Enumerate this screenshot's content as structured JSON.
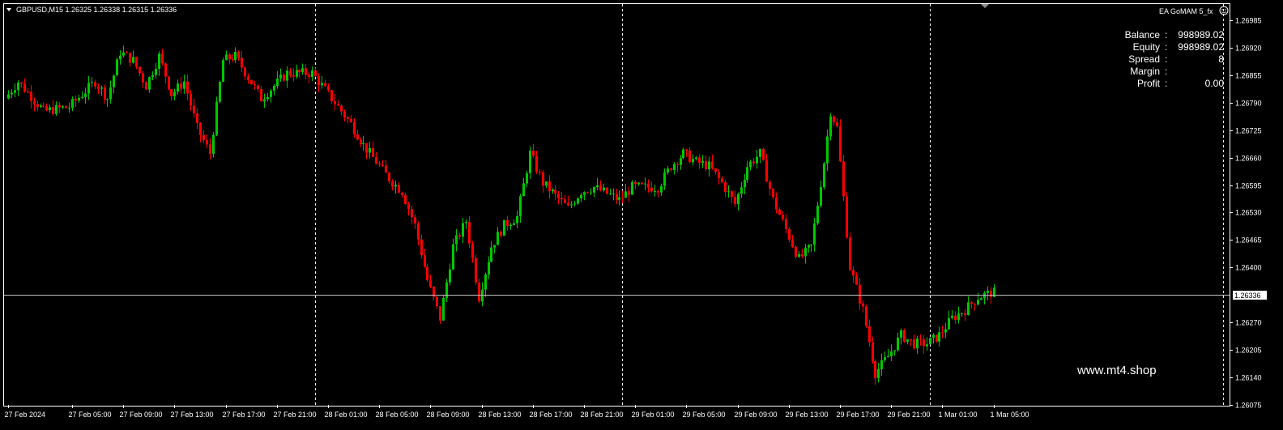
{
  "header": {
    "symbol_line": "GBPUSD,M15  1.26325 1.26338 1.26315 1.26336",
    "ea_label": "EA GoMAM 5_fx"
  },
  "account": {
    "rows": [
      {
        "label": "Balance",
        "sep": ":",
        "value": "998989.02"
      },
      {
        "label": "Equity",
        "sep": ":",
        "value": "998989.02"
      },
      {
        "label": "Spread",
        "sep": ":",
        "value": "8"
      },
      {
        "label": "Margin",
        "sep": ":",
        "value": ""
      },
      {
        "label": "Profit",
        "sep": ":",
        "value": "0.00"
      }
    ]
  },
  "watermark": "www.mt4.shop",
  "colors": {
    "background": "#000000",
    "up_candle": "#00c800",
    "down_candle": "#ff0000",
    "grid": "#ffffff",
    "price_line": "#c0c0c0"
  },
  "chart_data": {
    "type": "candlestick",
    "symbol": "GBPUSD",
    "timeframe": "M15",
    "current_price": 1.26336,
    "ylim": [
      1.26075,
      1.26985
    ],
    "y_ticks": [
      "1.26985",
      "1.26920",
      "1.26855",
      "1.26790",
      "1.26725",
      "1.26660",
      "1.26595",
      "1.26530",
      "1.26465",
      "1.26400",
      "1.26270",
      "1.26205",
      "1.26140",
      "1.26075"
    ],
    "current_price_label": "1.26336",
    "x_ticks": [
      "27 Feb 2024",
      "27 Feb 05:00",
      "27 Feb 09:00",
      "27 Feb 13:00",
      "27 Feb 17:00",
      "27 Feb 21:00",
      "28 Feb 01:00",
      "28 Feb 05:00",
      "28 Feb 09:00",
      "28 Feb 13:00",
      "28 Feb 17:00",
      "28 Feb 21:00",
      "29 Feb 01:00",
      "29 Feb 05:00",
      "29 Feb 09:00",
      "29 Feb 13:00",
      "29 Feb 17:00",
      "29 Feb 21:00",
      "1 Mar 01:00",
      "1 Mar 05:00"
    ],
    "day_separators": [
      "28 Feb 00:00",
      "29 Feb 00:00",
      "1 Mar 00:00"
    ],
    "path": [
      [
        "27 Feb 2024",
        1.268
      ],
      [
        "27 Feb 01:00",
        1.2684
      ],
      [
        "27 Feb 03:00",
        1.2677
      ],
      [
        "27 Feb 05:00",
        1.2678
      ],
      [
        "27 Feb 07:00",
        1.2684
      ],
      [
        "27 Feb 08:00",
        1.268
      ],
      [
        "27 Feb 09:00",
        1.2691
      ],
      [
        "27 Feb 10:00",
        1.2689
      ],
      [
        "27 Feb 11:00",
        1.2683
      ],
      [
        "27 Feb 12:00",
        1.269
      ],
      [
        "27 Feb 13:00",
        1.2681
      ],
      [
        "27 Feb 14:00",
        1.2684
      ],
      [
        "27 Feb 15:00",
        1.2673
      ],
      [
        "27 Feb 16:00",
        1.2667
      ],
      [
        "27 Feb 17:00",
        1.2689
      ],
      [
        "27 Feb 18:00",
        1.269
      ],
      [
        "27 Feb 19:00",
        1.2685
      ],
      [
        "27 Feb 20:00",
        1.268
      ],
      [
        "27 Feb 21:00",
        1.2683
      ],
      [
        "27 Feb 22:00",
        1.2686
      ],
      [
        "28 Feb 00:00",
        1.2686
      ],
      [
        "28 Feb 01:00",
        1.2682
      ],
      [
        "28 Feb 02:00",
        1.2678
      ],
      [
        "28 Feb 03:00",
        1.2674
      ],
      [
        "28 Feb 04:00",
        1.2669
      ],
      [
        "28 Feb 05:00",
        1.2665
      ],
      [
        "28 Feb 06:00",
        1.2661
      ],
      [
        "28 Feb 07:00",
        1.2658
      ],
      [
        "28 Feb 08:00",
        1.265
      ],
      [
        "28 Feb 09:00",
        1.2637
      ],
      [
        "28 Feb 10:00",
        1.2628
      ],
      [
        "28 Feb 11:00",
        1.2645
      ],
      [
        "28 Feb 12:00",
        1.2651
      ],
      [
        "28 Feb 13:00",
        1.2633
      ],
      [
        "28 Feb 14:00",
        1.2645
      ],
      [
        "28 Feb 15:00",
        1.265
      ],
      [
        "28 Feb 16:00",
        1.2652
      ],
      [
        "28 Feb 17:00",
        1.2667
      ],
      [
        "28 Feb 18:00",
        1.266
      ],
      [
        "28 Feb 19:00",
        1.2657
      ],
      [
        "28 Feb 20:00",
        1.2654
      ],
      [
        "28 Feb 21:00",
        1.2658
      ],
      [
        "28 Feb 22:00",
        1.2659
      ],
      [
        "29 Feb 00:00",
        1.2656
      ],
      [
        "29 Feb 01:00",
        1.2659
      ],
      [
        "29 Feb 02:00",
        1.2659
      ],
      [
        "29 Feb 03:00",
        1.2659
      ],
      [
        "29 Feb 04:00",
        1.2664
      ],
      [
        "29 Feb 05:00",
        1.2667
      ],
      [
        "29 Feb 06:00",
        1.2665
      ],
      [
        "29 Feb 07:00",
        1.2664
      ],
      [
        "29 Feb 08:00",
        1.266
      ],
      [
        "29 Feb 09:00",
        1.2655
      ],
      [
        "29 Feb 10:00",
        1.2664
      ],
      [
        "29 Feb 11:00",
        1.2667
      ],
      [
        "29 Feb 12:00",
        1.2656
      ],
      [
        "29 Feb 13:00",
        1.2649
      ],
      [
        "29 Feb 14:00",
        1.2642
      ],
      [
        "29 Feb 15:00",
        1.2645
      ],
      [
        "29 Feb 16:00",
        1.2665
      ],
      [
        "29 Feb 16:30",
        1.2677
      ],
      [
        "29 Feb 17:00",
        1.2673
      ],
      [
        "29 Feb 18:00",
        1.264
      ],
      [
        "29 Feb 19:00",
        1.263
      ],
      [
        "29 Feb 20:00",
        1.2615
      ],
      [
        "29 Feb 21:00",
        1.2619
      ],
      [
        "29 Feb 22:00",
        1.2624
      ],
      [
        "29 Feb 23:00",
        1.2622
      ],
      [
        "1 Mar 00:00",
        1.2622
      ],
      [
        "1 Mar 01:00",
        1.2624
      ],
      [
        "1 Mar 02:00",
        1.2628
      ],
      [
        "1 Mar 03:00",
        1.263
      ],
      [
        "1 Mar 04:00",
        1.2633
      ],
      [
        "1 Mar 05:00",
        1.2634
      ]
    ]
  }
}
